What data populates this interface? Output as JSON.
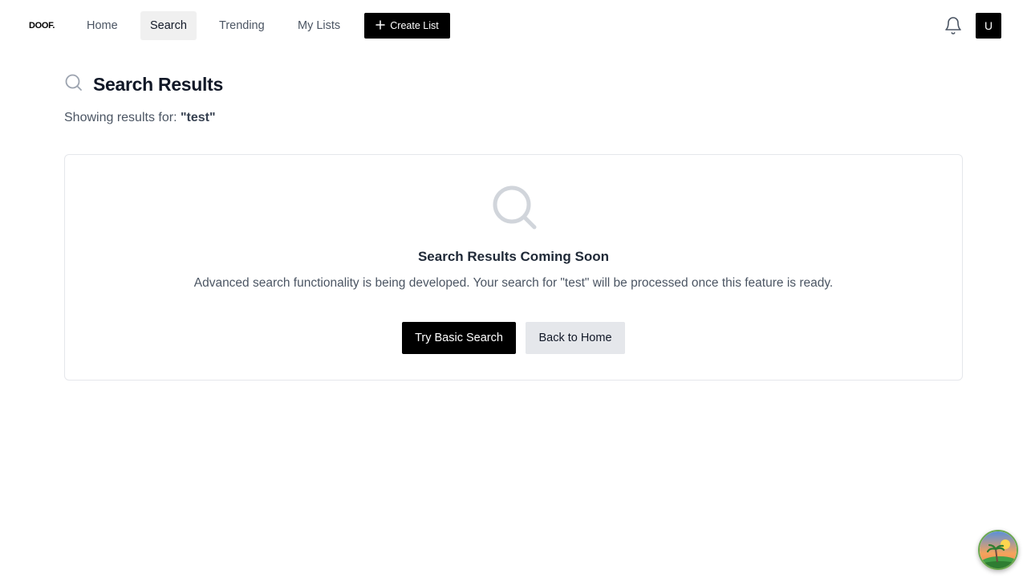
{
  "nav": {
    "logo": "DOOF.",
    "items": [
      {
        "label": "Home",
        "active": false
      },
      {
        "label": "Search",
        "active": true
      },
      {
        "label": "Trending",
        "active": false
      },
      {
        "label": "My Lists",
        "active": false
      }
    ],
    "create_label": "Create List",
    "avatar_initial": "U",
    "icons": {
      "create": "plus-icon",
      "notifications": "bell-icon"
    }
  },
  "header": {
    "title": "Search Results",
    "icon": "search-icon",
    "showing_prefix": "Showing results for:",
    "query": "\"test\""
  },
  "card": {
    "icon": "search-icon",
    "title": "Search Results Coming Soon",
    "description": "Advanced search functionality is being developed. Your search for \"test\" will be processed once this feature is ready.",
    "primary_button": "Try Basic Search",
    "secondary_button": "Back to Home"
  },
  "colors": {
    "primary": "#000000",
    "secondary_button_bg": "#e5e7eb",
    "active_nav_bg": "#f0f0f0",
    "icon_gray": "#d1d5db"
  }
}
